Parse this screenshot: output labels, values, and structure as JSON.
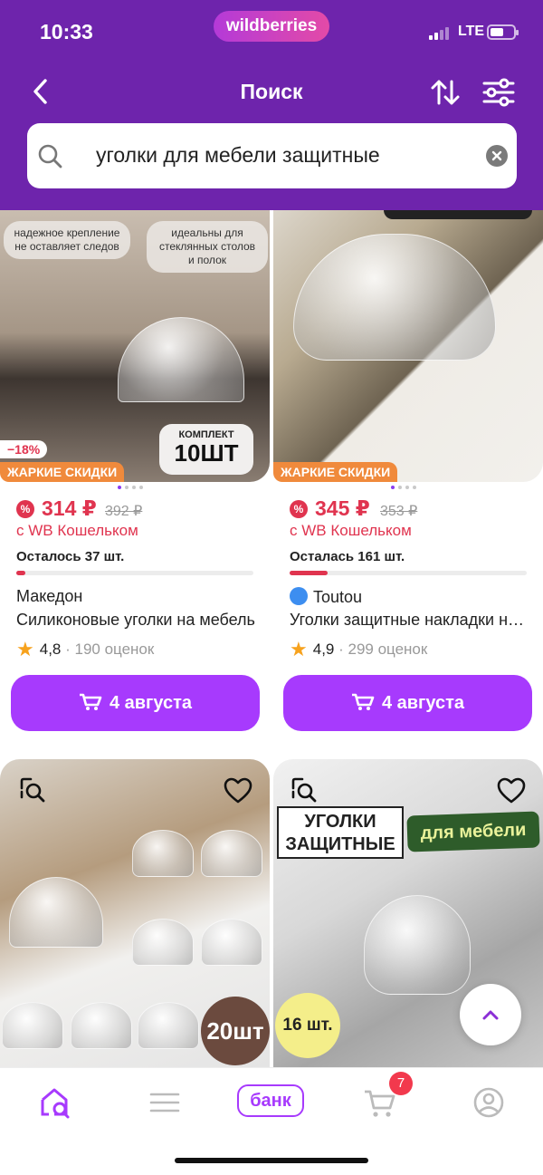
{
  "status_bar": {
    "time": "10:33",
    "network": "LTE"
  },
  "app": {
    "logo": "wildberries",
    "title": "Поиск"
  },
  "colors": {
    "header": "#6e24ac",
    "accent": "#a73afd",
    "price": "#e0344f",
    "hot_sale": "#f08a3c",
    "star": "#f7a21d"
  },
  "icons": {
    "back": "chevron-left-icon",
    "sort": "sort-arrows-icon",
    "filter": "filter-sliders-icon",
    "search": "search-icon",
    "clear": "clear-icon",
    "cart": "cart-icon",
    "favorite": "heart-icon",
    "similar": "similar-search-icon",
    "scroll_top": "chevron-up-icon",
    "verified": "verified-check-icon"
  },
  "search": {
    "query": "уголки для мебели защитные"
  },
  "products": [
    {
      "image_tags": [
        "надежное крепление не оставляет следов",
        "идеальны для стеклянных столов и полок"
      ],
      "image_badge_top": "КОМПЛЕКТ",
      "image_badge_bottom": "10ШТ",
      "discount": "−18%",
      "hot_label": "ЖАРКИЕ СКИДКИ",
      "price": "314 ₽",
      "old_price": "392 ₽",
      "wallet_note": "с WB Кошельком",
      "stock": "Осталось 37 шт.",
      "stock_level": 0.04,
      "brand": "Македон",
      "verified": false,
      "name": "Силиконовые уголки на мебель",
      "rating": "4,8",
      "reviews": "· 190 оценок",
      "delivery": "4 августа"
    },
    {
      "hot_label": "ЖАРКИЕ СКИДКИ",
      "price": "345 ₽",
      "old_price": "353 ₽",
      "wallet_note": "с WB Кошельком",
      "stock": "Осталась 161 шт.",
      "stock_level": 0.16,
      "brand": "Toutou",
      "verified": true,
      "name": "Уголки защитные накладки на мебель",
      "rating": "4,9",
      "reviews": "· 299 оценок",
      "delivery": "4 августа"
    },
    {
      "promo": "20шт"
    },
    {
      "title_line1": "УГОЛКИ",
      "title_line2": "ЗАЩИТНЫЕ",
      "label": "для мебели",
      "promo": "16 шт."
    }
  ],
  "bottom_nav": {
    "bank_label": "банк",
    "cart_count": "7"
  }
}
